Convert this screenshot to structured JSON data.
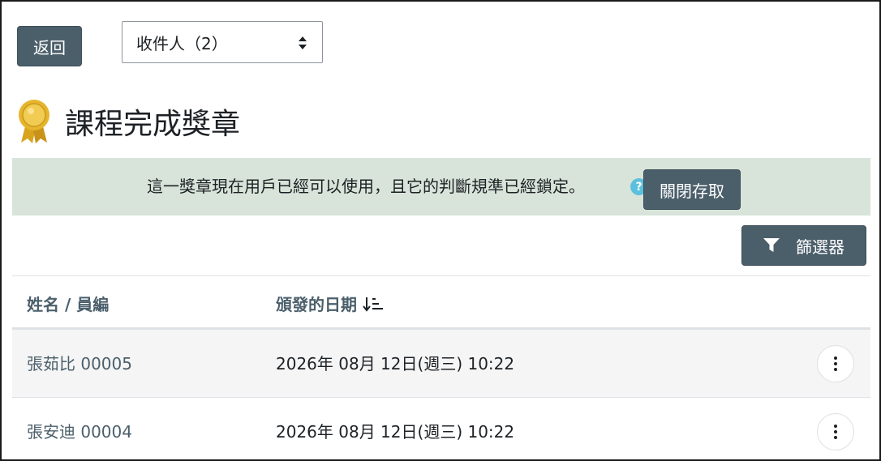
{
  "nav": {
    "back_label": "返回"
  },
  "select": {
    "value": "收件人（2）"
  },
  "badge": {
    "title": "課程完成獎章"
  },
  "notice": {
    "text": "這一獎章現在用戶已經可以使用，且它的判斷規準已經鎖定。",
    "help_icon": "?",
    "lock_label": "關閉存取"
  },
  "filter": {
    "label": "篩選器"
  },
  "table": {
    "headers": {
      "name": "姓名 / 員編",
      "date": "頒發的日期"
    },
    "rows": [
      {
        "name": "張茹比 00005",
        "date": "2026年 08月 12日(週三) 10:22"
      },
      {
        "name": "張安迪 00004",
        "date": "2026年 08月 12日(週三) 10:22"
      }
    ]
  },
  "colors": {
    "button": "#4b5f6b",
    "notice_bg": "#d8e4d9",
    "help": "#5bc0de"
  }
}
